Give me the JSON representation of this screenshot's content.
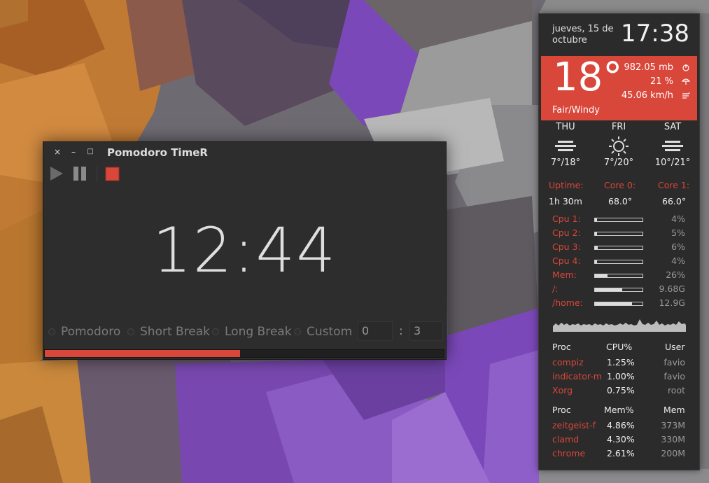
{
  "pomodoro": {
    "title": "Pomodoro TimeR",
    "window_buttons": {
      "close": "×",
      "minimize": "–",
      "maximize": "□"
    },
    "time": "12:44",
    "modes": [
      "Pomodoro",
      "Short Break",
      "Long Break",
      "Custom"
    ],
    "custom_minutes": "0",
    "custom_separator": ":",
    "custom_seconds": "3",
    "progress_fraction": 0.49,
    "accent": "#d9463a"
  },
  "conky": {
    "date": "jueves, 15 de octubre",
    "time": "17:38",
    "weather": {
      "temp": "18°",
      "pressure": "982.05 mb",
      "humidity": "21 %",
      "wind": "45.06 km/h",
      "condition": "Fair/Windy",
      "background": "#d9463a"
    },
    "forecast": [
      {
        "day": "THU",
        "icon": "clouds-icon",
        "temp": "7°/18°"
      },
      {
        "day": "FRI",
        "icon": "sun-icon",
        "temp": "7°/20°"
      },
      {
        "day": "SAT",
        "icon": "clouds-icon",
        "temp": "10°/21°"
      }
    ],
    "stats": [
      {
        "label": "Uptime:",
        "value": "1h 30m"
      },
      {
        "label": "Core 0:",
        "value": "68.0°"
      },
      {
        "label": "Core 1:",
        "value": "66.0°"
      }
    ],
    "resources": [
      {
        "label": "Cpu 1:",
        "fraction": 0.04,
        "value": "4%"
      },
      {
        "label": "Cpu 2:",
        "fraction": 0.05,
        "value": "5%"
      },
      {
        "label": "Cpu 3:",
        "fraction": 0.06,
        "value": "6%"
      },
      {
        "label": "Cpu 4:",
        "fraction": 0.04,
        "value": "4%"
      },
      {
        "label": "Mem:",
        "fraction": 0.26,
        "value": "26%"
      },
      {
        "label": "/:",
        "fraction": 0.58,
        "value": "9.68G"
      },
      {
        "label": "/home:",
        "fraction": 0.78,
        "value": "12.9G"
      }
    ],
    "cpu_table": {
      "headers": [
        "Proc",
        "CPU%",
        "User"
      ],
      "rows": [
        [
          "compiz",
          "1.25%",
          "favio"
        ],
        [
          "indicator-m",
          "1.00%",
          "favio"
        ],
        [
          "Xorg",
          "0.75%",
          "root"
        ]
      ]
    },
    "mem_table": {
      "headers": [
        "Proc",
        "Mem%",
        "Mem"
      ],
      "rows": [
        [
          "zeitgeist-f",
          "4.86%",
          "373M"
        ],
        [
          "clamd",
          "4.30%",
          "330M"
        ],
        [
          "chrome",
          "2.61%",
          "200M"
        ]
      ]
    }
  }
}
